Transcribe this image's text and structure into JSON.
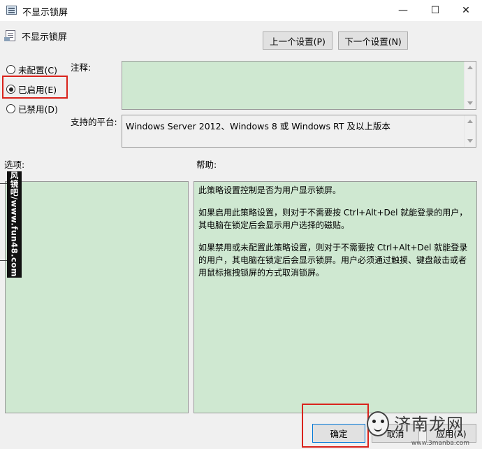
{
  "window": {
    "title": "不显示锁屏",
    "controls": {
      "minimize": "—",
      "maximize": "☐",
      "close": "✕"
    }
  },
  "header": {
    "setting_name": "不显示锁屏",
    "prev_button": "上一个设置(P)",
    "next_button": "下一个设置(N)"
  },
  "options": {
    "not_configured": "未配置(C)",
    "enabled": "已启用(E)",
    "disabled": "已禁用(D)",
    "selected": "enabled"
  },
  "comment": {
    "label": "注释:",
    "value": ""
  },
  "platform": {
    "label": "支持的平台:",
    "value": "Windows Server 2012、Windows 8 或 Windows RT 及以上版本"
  },
  "options_section": {
    "label": "选项:"
  },
  "help_section": {
    "label": "帮助:",
    "paragraphs": [
      "此策略设置控制是否为用户显示锁屏。",
      "如果启用此策略设置，则对于不需要按 Ctrl+Alt+Del 就能登录的用户，其电脑在锁定后会显示用户选择的磁贴。",
      "如果禁用或未配置此策略设置，则对于不需要按 Ctrl+Alt+Del 就能登录的用户，其电脑在锁定后会显示锁屏。用户必须通过触摸、键盘敲击或者用鼠标拖拽锁屏的方式取消锁屏。"
    ]
  },
  "footer": {
    "ok": "确定",
    "cancel": "取消",
    "apply": "应用(A)"
  },
  "watermarks": {
    "left_strip": "风镜吧/www.fun48.com",
    "logo": "济南龙网",
    "url": "www.3manba.com"
  },
  "colors": {
    "highlight_red": "#d9231c",
    "panel_green": "#cfe8d1",
    "dialog_bg": "#f0f0f0"
  }
}
